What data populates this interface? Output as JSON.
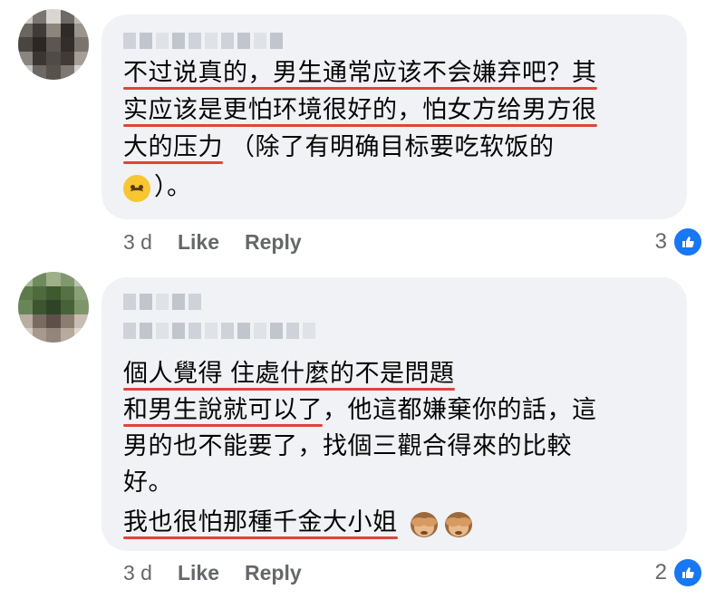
{
  "comments": [
    {
      "lines": [
        {
          "segments": [
            {
              "text": "不过说真的，男生通常应该不会嫌弃吧？其",
              "underline": true
            }
          ]
        },
        {
          "segments": [
            {
              "text": "实应该是更怕环境很好的，怕女方给男方很",
              "underline": true
            }
          ]
        },
        {
          "segments": [
            {
              "text": "大的压力",
              "underline": true
            },
            {
              "text": " （除了有明确目标要吃软饭的",
              "underline": false
            }
          ]
        },
        {
          "segments": [
            {
              "text": "）。",
              "underline": false
            }
          ]
        }
      ],
      "emoji_icon": "upside-down-face-icon",
      "time": "3 d",
      "like_label": "Like",
      "reply_label": "Reply",
      "reaction_count": "3"
    },
    {
      "lines": [
        {
          "segments": [
            {
              "text": "個人覺得 住處什麼的不是問題",
              "underline": true
            }
          ]
        },
        {
          "segments": [
            {
              "text": "和男生說就可以了",
              "underline": true
            },
            {
              "text": "，他這都嫌棄你的話，這",
              "underline": false
            }
          ]
        },
        {
          "segments": [
            {
              "text": "男的也不能要了，找個三觀合得來的比較",
              "underline": false
            }
          ]
        },
        {
          "segments": [
            {
              "text": "好。",
              "underline": false
            }
          ]
        },
        {
          "segments": [
            {
              "text": "我也很怕那種千金大小姐",
              "underline": true
            }
          ]
        }
      ],
      "emoji_icon": "see-no-evil-monkey-icon",
      "time": "3 d",
      "like_label": "Like",
      "reply_label": "Reply",
      "reaction_count": "2"
    }
  ],
  "colors": {
    "bubble": "#f0f2f5",
    "underline": "#e0443a",
    "like_blue": "#1877f2",
    "meta_text": "#65676b"
  }
}
